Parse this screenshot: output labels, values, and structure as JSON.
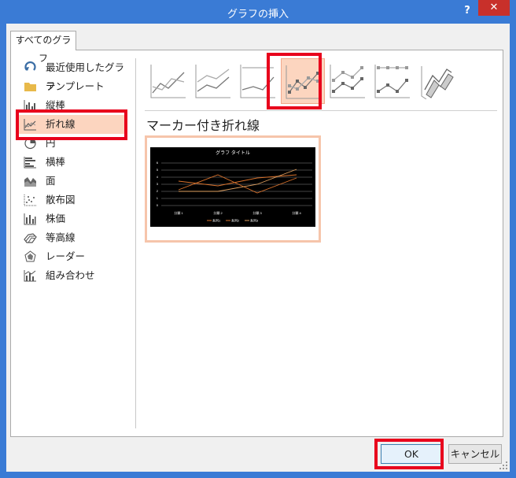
{
  "dialog": {
    "title": "グラフの挿入",
    "help_label": "?",
    "close_label": "✕"
  },
  "tab": {
    "label": "すべてのグラフ"
  },
  "nav": {
    "items": [
      {
        "label": "最近使用したグラフ",
        "icon": "recent-icon"
      },
      {
        "label": "テンプレート",
        "icon": "folder-icon"
      },
      {
        "label": "縦棒",
        "icon": "column-chart-icon"
      },
      {
        "label": "折れ線",
        "icon": "line-chart-icon",
        "selected": true
      },
      {
        "label": "円",
        "icon": "pie-chart-icon"
      },
      {
        "label": "横棒",
        "icon": "bar-chart-icon"
      },
      {
        "label": "面",
        "icon": "area-chart-icon"
      },
      {
        "label": "散布図",
        "icon": "scatter-chart-icon"
      },
      {
        "label": "株価",
        "icon": "stock-chart-icon"
      },
      {
        "label": "等高線",
        "icon": "surface-chart-icon"
      },
      {
        "label": "レーダー",
        "icon": "radar-chart-icon"
      },
      {
        "label": "組み合わせ",
        "icon": "combo-chart-icon"
      }
    ]
  },
  "subtypes": [
    {
      "icon": "line-icon"
    },
    {
      "icon": "stacked-line-icon"
    },
    {
      "icon": "100-stacked-line-icon"
    },
    {
      "icon": "line-with-markers-icon",
      "selected": true
    },
    {
      "icon": "stacked-line-with-markers-icon"
    },
    {
      "icon": "100-stacked-line-with-markers-icon"
    },
    {
      "icon": "3d-line-icon"
    }
  ],
  "selected_subtype_label": "マーカー付き折れ線",
  "preview": {
    "title": "グラフ タイトル",
    "y_ticks": [
      "0",
      "1",
      "2",
      "3",
      "4",
      "5",
      "6"
    ],
    "categories": [
      "分類 1",
      "分類 2",
      "分類 3",
      "分類 4"
    ],
    "legend": [
      "系列1",
      "系列2",
      "系列3"
    ],
    "colors": {
      "background": "#000000",
      "series": [
        "#d9722c",
        "#d9722c",
        "#e0a060"
      ]
    }
  },
  "buttons": {
    "ok": "OK",
    "cancel": "キャンセル"
  },
  "colors": {
    "titlebar": "#3a7bd5",
    "selection": "#fcd5bf",
    "highlight": "#e8001c"
  }
}
